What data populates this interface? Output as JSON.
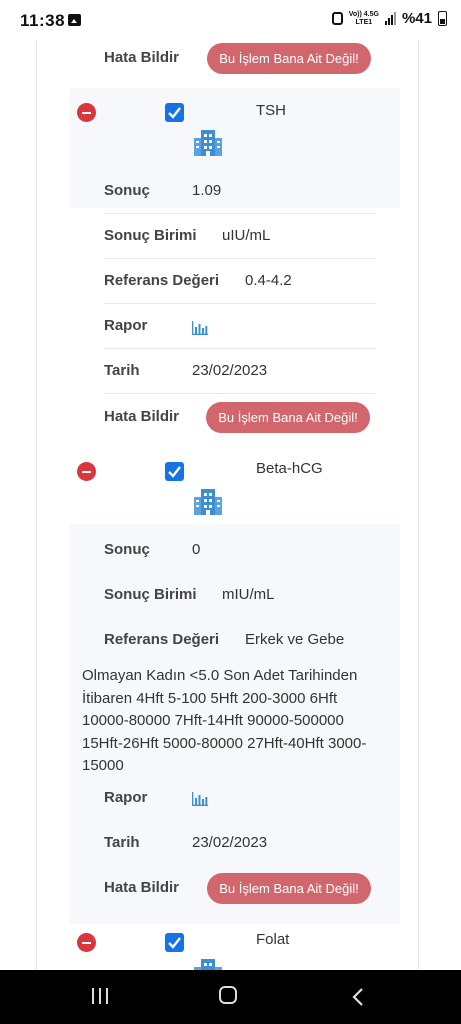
{
  "status_bar": {
    "time": "11:38",
    "network_top": "Vo)) 4.5G",
    "network_bottom": "LTE1",
    "battery": "%41"
  },
  "labels": {
    "sonuc": "Sonuç",
    "sonuc_birimi": "Sonuç Birimi",
    "referans": "Referans Değeri",
    "rapor": "Rapor",
    "tarih": "Tarih",
    "hata": "Hata Bildir",
    "error_button": "Bu İşlem Bana Ait Değil!"
  },
  "tests": [
    {
      "name": "TSH",
      "sonuc": "1.09",
      "birim": "uIU/mL",
      "referans": "0.4-4.2",
      "tarih": "23/02/2023"
    },
    {
      "name": "Beta-hCG",
      "sonuc": "0",
      "birim": "mIU/mL",
      "referans_first": "Erkek ve Gebe",
      "referans_rest": "Olmayan Kadın <5.0 Son Adet Tarihinden İtibaren 4Hft 5-100 5Hft 200-3000 6Hft 10000-80000 7Hft-14Hft 90000-500000 15Hft-26Hft 5000-80000 27Hft-40Hft 3000-15000",
      "tarih": "23/02/2023"
    },
    {
      "name": "Folat"
    }
  ],
  "icons": {
    "remove": "minus-circle-icon",
    "checkbox": "check-icon",
    "building": "hospital-building-icon",
    "report": "bar-chart-icon"
  },
  "colors": {
    "error_button": "#d1676d",
    "remove": "#d9363e",
    "checkbox": "#1573e5",
    "icon_blue": "#3d8fd4"
  }
}
